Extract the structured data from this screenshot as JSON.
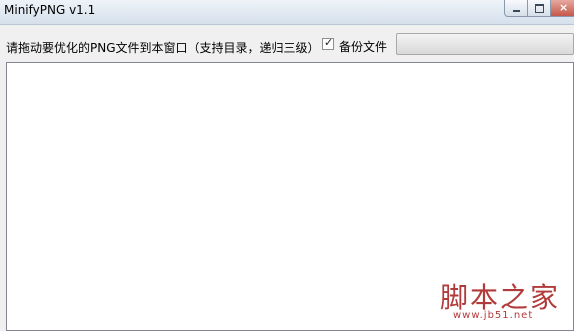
{
  "window": {
    "title": "MinifyPNG v1.1",
    "close_glyph": "×"
  },
  "toolbar": {
    "instruction": "请拖动要优化的PNG文件到本窗口（支持目录，递归三级）",
    "backup_label": "备份文件",
    "backup_checked": true,
    "check_glyph": "✓"
  },
  "watermark": {
    "text": "脚本之家",
    "url": "www.jb51.net"
  },
  "colors": {
    "watermark": "#b13a3a",
    "titlebar": "#d5e0ec"
  }
}
